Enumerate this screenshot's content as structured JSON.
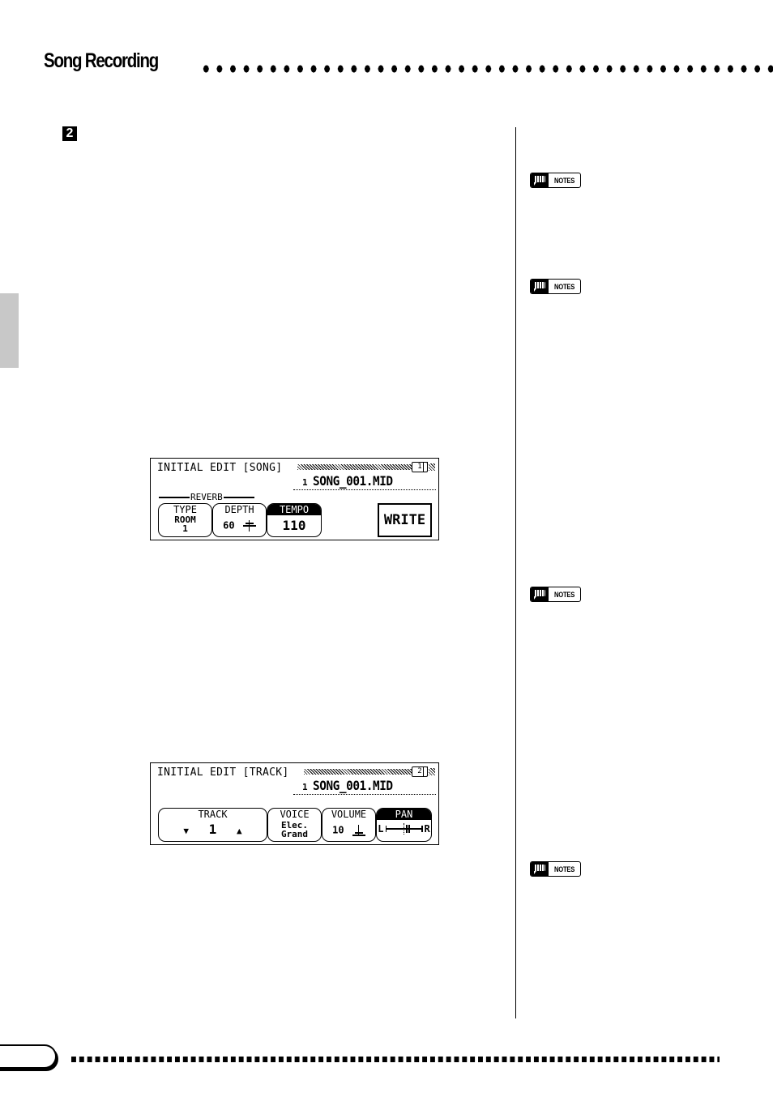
{
  "header": {
    "title": "Song Recording"
  },
  "step": {
    "number": "2"
  },
  "notes_badges": [
    {
      "label": "NOTES"
    },
    {
      "label": "NOTES"
    },
    {
      "label": "NOTES"
    },
    {
      "label": "NOTES"
    }
  ],
  "lcd_song": {
    "title": "INITIAL EDIT [SONG]",
    "page": "1",
    "file_number": "1",
    "file_name": "SONG_001.MID",
    "group_label": "REVERB",
    "buttons": [
      {
        "label": "TYPE",
        "value_line1": "ROOM",
        "value_line2": "1",
        "active": false
      },
      {
        "label": "DEPTH",
        "value": "60",
        "active": false
      },
      {
        "label": "TEMPO",
        "value": "110",
        "active": true
      }
    ],
    "write_label": "WRITE",
    "reverb_depth": 60,
    "tempo": 110
  },
  "lcd_track": {
    "title": "INITIAL EDIT [TRACK]",
    "page": "2",
    "file_number": "1",
    "file_name": "SONG_001.MID",
    "buttons": [
      {
        "label": "TRACK",
        "value": "1",
        "down_icon": "▼",
        "up_icon": "▲",
        "active": false
      },
      {
        "label": "VOICE",
        "value_line1": "Elec.",
        "value_line2": "Grand",
        "active": false
      },
      {
        "label": "VOLUME",
        "value": "10",
        "active": false
      },
      {
        "label": "PAN",
        "left": "L",
        "right": "R",
        "active": true
      }
    ],
    "volume": 10
  },
  "colors": {
    "ink": "#000000",
    "paper": "#ffffff",
    "side_tab": "#c8c8c8"
  }
}
